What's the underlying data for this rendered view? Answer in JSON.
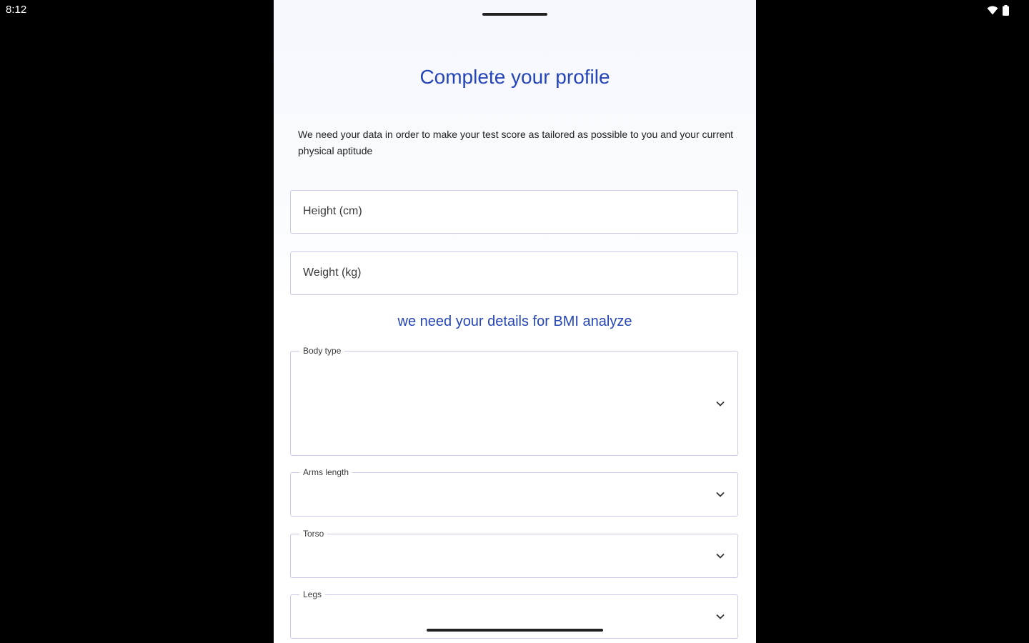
{
  "status_bar": {
    "time": "8:12",
    "icons": [
      "wifi-icon",
      "battery-icon"
    ]
  },
  "profile": {
    "title": "Complete your profile",
    "description": "We need your data in order to make your test score as tailored as possible to you and your current physical aptitude",
    "height_field": {
      "placeholder": "Height (cm)",
      "value": ""
    },
    "weight_field": {
      "placeholder": "Weight (kg)",
      "value": ""
    },
    "bmi_note": "we need  your details for BMI analyze",
    "dropdowns": {
      "body_type": {
        "label": "Body type",
        "value": ""
      },
      "arms_length": {
        "label": "Arms length",
        "value": ""
      },
      "torso": {
        "label": "Torso",
        "value": ""
      },
      "legs": {
        "label": "Legs",
        "value": ""
      }
    }
  },
  "colors": {
    "accent": "#2545b8",
    "border": "#c7c9e6",
    "background": "#000000",
    "sheet": "#f8fafe"
  }
}
